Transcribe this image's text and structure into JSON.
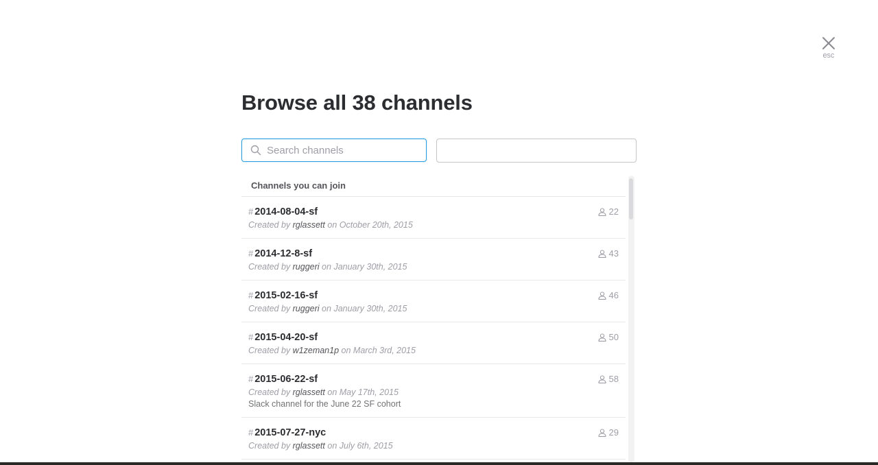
{
  "close": {
    "label": "esc"
  },
  "title": "Browse all 38 channels",
  "search": {
    "placeholder": "Search channels",
    "value": ""
  },
  "sort": {
    "selected": ""
  },
  "list": {
    "section_label": "Channels you can join",
    "created_by_label": "Created by",
    "on_label": "on",
    "channels": [
      {
        "name": "2014-08-04-sf",
        "creator": "rglassett",
        "date": "October 20th, 2015",
        "members": "22",
        "purpose": ""
      },
      {
        "name": "2014-12-8-sf",
        "creator": "ruggeri",
        "date": "January 30th, 2015",
        "members": "43",
        "purpose": ""
      },
      {
        "name": "2015-02-16-sf",
        "creator": "ruggeri",
        "date": "January 30th, 2015",
        "members": "46",
        "purpose": ""
      },
      {
        "name": "2015-04-20-sf",
        "creator": "w1zeman1p",
        "date": "March 3rd, 2015",
        "members": "50",
        "purpose": ""
      },
      {
        "name": "2015-06-22-sf",
        "creator": "rglassett",
        "date": "May 17th, 2015",
        "members": "58",
        "purpose": "Slack channel for the June 22 SF cohort"
      },
      {
        "name": "2015-07-27-nyc",
        "creator": "rglassett",
        "date": "July 6th, 2015",
        "members": "29",
        "purpose": ""
      }
    ]
  },
  "colors": {
    "accent": "#2d9ee0",
    "text": "#2c2d30",
    "muted": "#9e9ea6"
  },
  "icons": {
    "close": "close-icon",
    "search": "search-icon",
    "members": "member-icon"
  }
}
